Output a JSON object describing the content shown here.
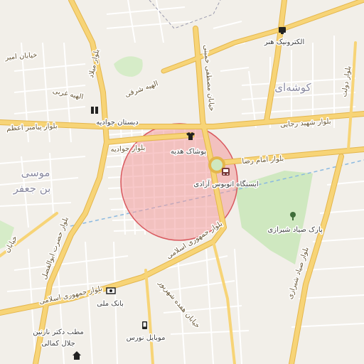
{
  "map": {
    "colors": {
      "background": "#f2efe9",
      "minor_road": "#ffffff",
      "major_road": "#f7d477",
      "major_road_casing": "#e4b64c",
      "park": "#cfe8c0",
      "rail": "#8bb9e0",
      "highlight_fill": "#f29a9c",
      "highlight_stroke": "#d9595f"
    },
    "roads": {
      "r1": "خیابان امیر",
      "r2": "بلوار میلاد",
      "r3": "الهیه شرقی",
      "r4": "الهیه غربی",
      "r5": "بلوار پیامبر اعظم",
      "r6": "بلوار جوادیه",
      "r7": "بلوار امام رضا",
      "r8": "بلوار شهید رجایی",
      "r9": "خیابان مصطفی خمینی",
      "r10": "بلوار حضرت ابوالفضل",
      "r11": "بلوار جمهوری اسلامی",
      "r12": "بلوار جمهوری اسلامی",
      "r13": "بلوار صیاد شیرازی",
      "r14": "خیابان هفده شهریور",
      "r15": "بلوار دولت",
      "r16": "خیابان"
    },
    "areas": {
      "a1": "کوشه‌ای",
      "a2": "موسی",
      "a3": "بن جعفر"
    },
    "pois": {
      "p1": "الکترونیک هنر",
      "p2": "دبستان جوادیه",
      "p3": "پوشاک هدیه",
      "p4": "ایستگاه اتوبوس آزادی",
      "p5": "پارک صیاد شیرازی",
      "p6": "بانک ملی",
      "p7": "موبایل نورس",
      "p8": "مطب دکتر نازنین",
      "p9": "جلال کمالی"
    },
    "icons": [
      "electronics-icon",
      "school-icon",
      "clothing-icon",
      "bus-stop-icon",
      "park-tree-icon",
      "bank-icon",
      "phone-shop-icon",
      "doctor-icon"
    ]
  }
}
